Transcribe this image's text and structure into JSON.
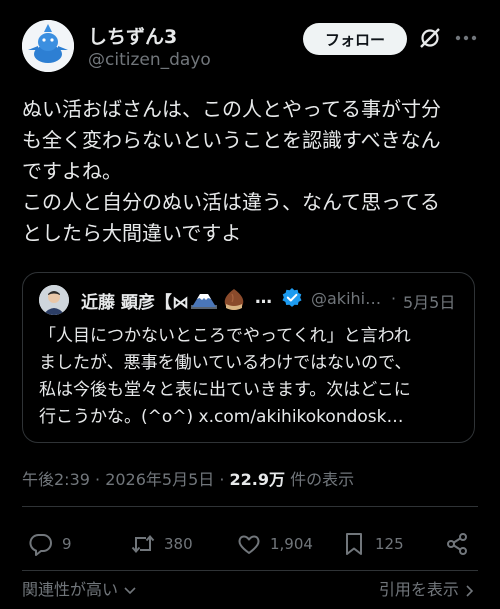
{
  "author": {
    "name": "しちずん3",
    "handle": "@citizen_dayo"
  },
  "follow_label": "フォロー",
  "tweet_text": "ぬい活おばさんは、この人とやってる事が寸分\nも全く変わらないということを認識すべきなん\nですよね。\nこの人と自分のぬい活は違う、なんて思ってる\nとしたら大間違いですよ",
  "quote": {
    "name": "近藤 顕彦【⋈",
    "ellipsis": "…",
    "handle": "@akihi…",
    "dot": "·",
    "date": "5月5日",
    "text": "「人目につかないところでやってくれ」と言われ\nましたが、悪事を働いているわけではないので、\n私は今後も堂々と表に出ていきます。次はどこに\n行こうかな。(^o^) x.com/akihikokondosk…"
  },
  "meta": {
    "time": "午後2:39 · 2026年5月5日 · ",
    "views": "22.9万",
    "views_label": " 件の表示"
  },
  "actions": {
    "replies": "9",
    "retweets": "380",
    "likes": "1,904",
    "bookmarks": "125"
  },
  "footer": {
    "sort_label": "関連性が高い",
    "quotes_label": "引用を表示"
  },
  "colors": {
    "background": "#000000",
    "text": "#e7e9ea",
    "muted": "#71767b",
    "verified": "#1d9bf0"
  }
}
